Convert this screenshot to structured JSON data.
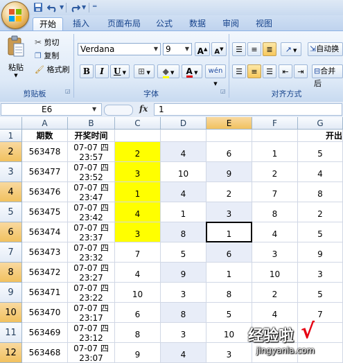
{
  "ribbon_tabs": [
    "开始",
    "插入",
    "页面布局",
    "公式",
    "数据",
    "审阅",
    "视图"
  ],
  "clipboard": {
    "paste_label": "粘贴",
    "cut_label": "剪切",
    "copy_label": "复制",
    "format_painter_label": "格式刷",
    "group_label": "剪贴板"
  },
  "font": {
    "font_name": "Verdana",
    "font_size": "9",
    "bold": "B",
    "italic": "I",
    "underline": "U",
    "group_label": "字体",
    "grow_label": "A",
    "shrink_label": "A",
    "color_label": "A",
    "phonetic_label": "wén"
  },
  "alignment": {
    "wrap_label": "自动换",
    "merge_label": "合并后",
    "group_label": "对齐方式"
  },
  "formula_bar": {
    "cell_ref": "E6",
    "fx": "fx",
    "content": "1"
  },
  "columns": [
    "A",
    "B",
    "C",
    "D",
    "E",
    "F",
    "G"
  ],
  "header_row": {
    "row": "1",
    "a": "期数",
    "b": "开奖时间",
    "g": "开出"
  },
  "rows": [
    {
      "row": "2",
      "a": "563478",
      "b1": "07-07 四",
      "b2": "23:57",
      "c": "2",
      "d": "4",
      "e": "6",
      "f": "1",
      "g": "5"
    },
    {
      "row": "3",
      "a": "563477",
      "b1": "07-07 四",
      "b2": "23:52",
      "c": "3",
      "d": "10",
      "e": "9",
      "f": "2",
      "g": "4"
    },
    {
      "row": "4",
      "a": "563476",
      "b1": "07-07 四",
      "b2": "23:47",
      "c": "1",
      "d": "4",
      "e": "2",
      "f": "7",
      "g": "8"
    },
    {
      "row": "5",
      "a": "563475",
      "b1": "07-07 四",
      "b2": "23:42",
      "c": "4",
      "d": "1",
      "e": "3",
      "f": "8",
      "g": "2"
    },
    {
      "row": "6",
      "a": "563474",
      "b1": "07-07 四",
      "b2": "23:37",
      "c": "3",
      "d": "8",
      "e": "1",
      "f": "4",
      "g": "5"
    },
    {
      "row": "7",
      "a": "563473",
      "b1": "07-07 四",
      "b2": "23:32",
      "c": "7",
      "d": "5",
      "e": "6",
      "f": "3",
      "g": "9"
    },
    {
      "row": "8",
      "a": "563472",
      "b1": "07-07 四",
      "b2": "23:27",
      "c": "4",
      "d": "9",
      "e": "1",
      "f": "10",
      "g": "3"
    },
    {
      "row": "9",
      "a": "563471",
      "b1": "07-07 四",
      "b2": "23:22",
      "c": "10",
      "d": "3",
      "e": "8",
      "f": "2",
      "g": "5"
    },
    {
      "row": "10",
      "a": "563470",
      "b1": "07-07 四",
      "b2": "23:17",
      "c": "6",
      "d": "8",
      "e": "5",
      "f": "4",
      "g": "7"
    },
    {
      "row": "11",
      "a": "563469",
      "b1": "07-07 四",
      "b2": "23:12",
      "c": "8",
      "d": "3",
      "e": "10",
      "f": "",
      "g": ""
    },
    {
      "row": "12",
      "a": "563468",
      "b1": "07-07 四",
      "b2": "23:07",
      "c": "9",
      "d": "4",
      "e": "3",
      "f": "",
      "g": ""
    }
  ],
  "watermark": {
    "brand": "经验啦",
    "check": "√",
    "url": "jingyanla.com"
  },
  "colors": {
    "highlight": "#ffff00",
    "selected_header": "#f4c96e",
    "ribbon_text": "#15428b"
  }
}
